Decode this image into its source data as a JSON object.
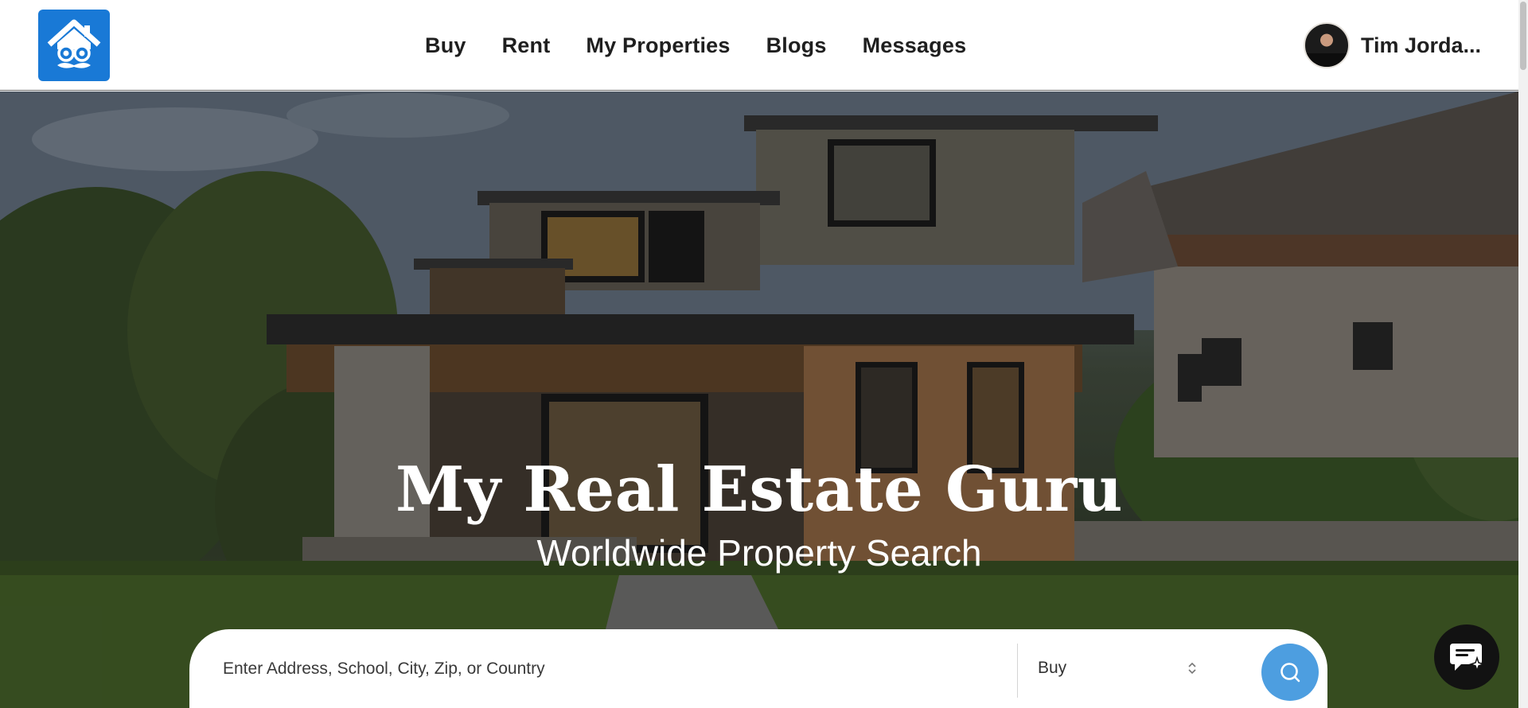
{
  "header": {
    "logo_name": "Real Estate Guru logo",
    "nav": [
      {
        "label": "Buy"
      },
      {
        "label": "Rent"
      },
      {
        "label": "My Properties"
      },
      {
        "label": "Blogs"
      },
      {
        "label": "Messages"
      }
    ],
    "user": {
      "name": "Tim Jorda..."
    }
  },
  "hero": {
    "title": "My Real Estate Guru",
    "subtitle": "Worldwide Property Search"
  },
  "search": {
    "placeholder": "Enter Address, School, City, Zip, or Country",
    "value": "",
    "mode_selected": "Buy",
    "search_icon": "search-icon"
  },
  "chat": {
    "icon": "chat-sparkle-icon"
  },
  "colors": {
    "brand_blue": "#1979d6",
    "search_button": "#4d9ee0",
    "chat_button": "#121212",
    "text_dark": "#1f1f1f"
  }
}
